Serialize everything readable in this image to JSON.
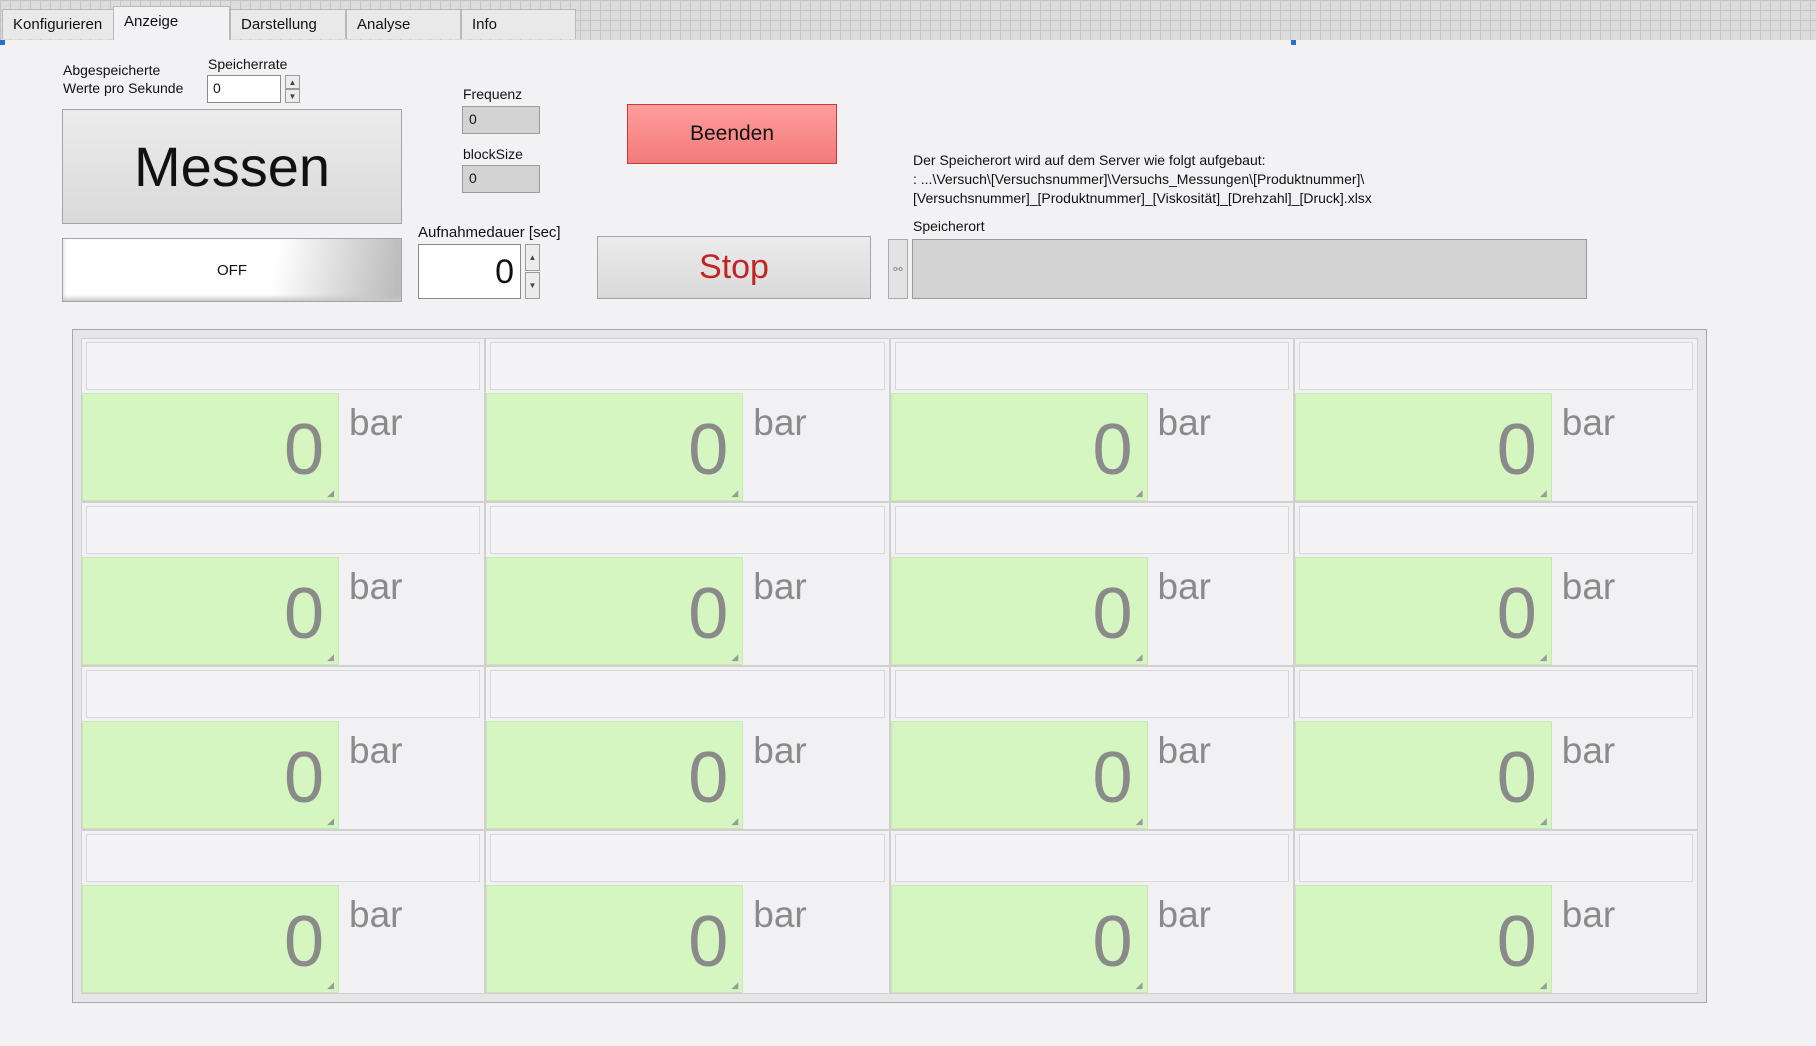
{
  "tabs": [
    {
      "label": "Konfigurieren",
      "active": false
    },
    {
      "label": "Anzeige",
      "active": true
    },
    {
      "label": "Darstellung",
      "active": false
    },
    {
      "label": "Analyse",
      "active": false
    },
    {
      "label": "Info",
      "active": false
    }
  ],
  "controls": {
    "saved_values_label_line1": "Abgespeicherte",
    "saved_values_label_line2": "Werte pro Sekunde",
    "speicherrate_label": "Speicherrate",
    "speicherrate_value": "0",
    "frequenz_label": "Frequenz",
    "frequenz_value": "0",
    "blocksize_label": "blockSize",
    "blocksize_value": "0",
    "messen_label": "Messen",
    "off_label": "OFF",
    "beenden_label": "Beenden",
    "aufnahmedauer_label": "Aufnahmedauer [sec]",
    "aufnahmedauer_value": "0",
    "stop_label": "Stop",
    "speicherort_label": "Speicherort",
    "speicherort_value": "",
    "info_line1": "Der Speicherort wird auf dem Server wie folgt aufgebaut:",
    "info_line2": ": ...\\Versuch\\[Versuchsnummer]\\Versuchs_Messungen\\[Produktnummer]\\",
    "info_line3": "[Versuchsnummer]_[Produktnummer]_[Viskosität]_[Drehzahl]_[Druck].xlsx"
  },
  "gauges": [
    {
      "label": "",
      "value": "0",
      "unit": "bar"
    },
    {
      "label": "",
      "value": "0",
      "unit": "bar"
    },
    {
      "label": "",
      "value": "0",
      "unit": "bar"
    },
    {
      "label": "",
      "value": "0",
      "unit": "bar"
    },
    {
      "label": "",
      "value": "0",
      "unit": "bar"
    },
    {
      "label": "",
      "value": "0",
      "unit": "bar"
    },
    {
      "label": "",
      "value": "0",
      "unit": "bar"
    },
    {
      "label": "",
      "value": "0",
      "unit": "bar"
    },
    {
      "label": "",
      "value": "0",
      "unit": "bar"
    },
    {
      "label": "",
      "value": "0",
      "unit": "bar"
    },
    {
      "label": "",
      "value": "0",
      "unit": "bar"
    },
    {
      "label": "",
      "value": "0",
      "unit": "bar"
    },
    {
      "label": "",
      "value": "0",
      "unit": "bar"
    },
    {
      "label": "",
      "value": "0",
      "unit": "bar"
    },
    {
      "label": "",
      "value": "0",
      "unit": "bar"
    },
    {
      "label": "",
      "value": "0",
      "unit": "bar"
    }
  ],
  "icons": {
    "spin_up": "▲",
    "spin_down": "▼",
    "resize": "◢",
    "browse": "⚯"
  },
  "colors": {
    "gauge_background": "#d5f6c1",
    "beenden_background": "#f47a7a",
    "stop_text": "#c22424",
    "selection_marker": "#2a6fd6"
  }
}
